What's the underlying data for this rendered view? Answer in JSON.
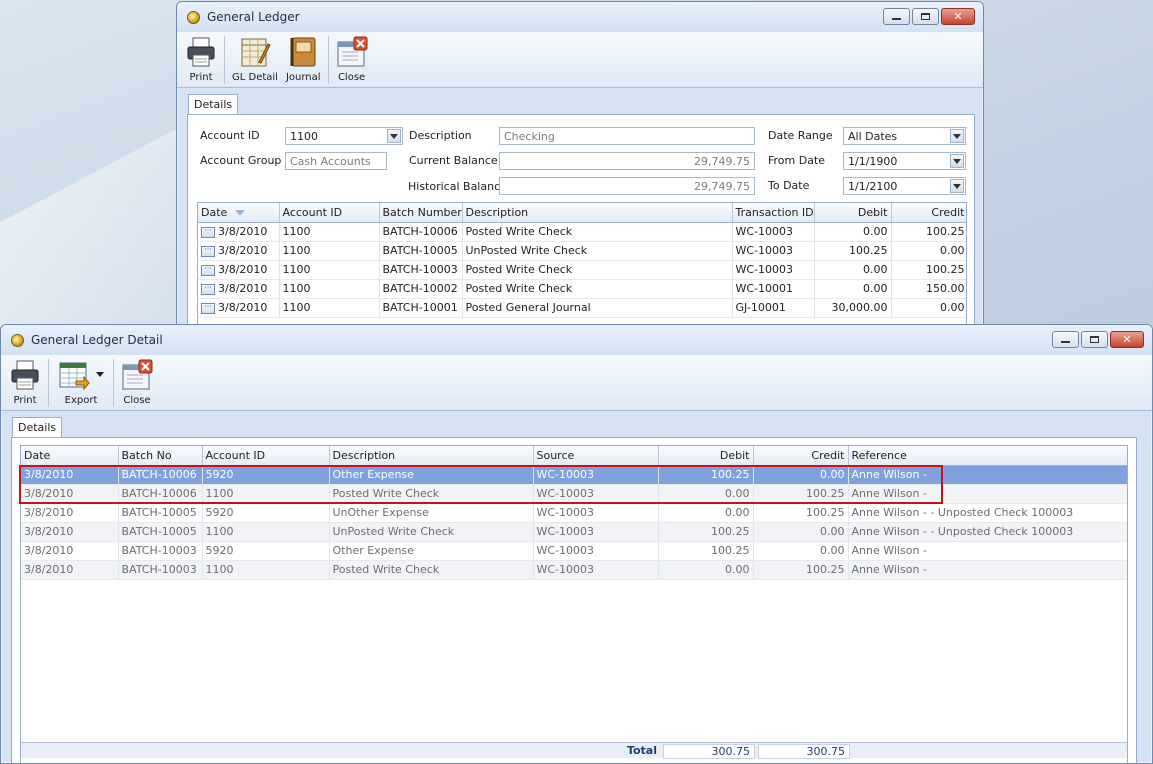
{
  "gl_window": {
    "title": "General Ledger",
    "toolbar": [
      "Print",
      "GL Detail",
      "Journal",
      "Close"
    ],
    "tab": "Details",
    "labels": {
      "account_id": "Account ID",
      "account_group": "Account Group",
      "description": "Description",
      "current_balance": "Current Balance",
      "historical_balance": "Historical Balance",
      "date_range": "Date Range",
      "from_date": "From Date",
      "to_date": "To Date"
    },
    "values": {
      "account_id": "1100",
      "account_group": "Cash Accounts",
      "description": "Checking",
      "current_balance": "29,749.75",
      "historical_balance": "29,749.75",
      "date_range": "All Dates",
      "from_date": "1/1/1900",
      "to_date": "1/1/2100"
    },
    "columns": [
      "Date",
      "Account ID",
      "Batch Number",
      "Description",
      "Transaction ID",
      "Debit",
      "Credit"
    ],
    "rows": [
      [
        "3/8/2010",
        "1100",
        "BATCH-10006",
        "Posted Write Check",
        "WC-10003",
        "0.00",
        "100.25"
      ],
      [
        "3/8/2010",
        "1100",
        "BATCH-10005",
        "UnPosted Write Check",
        "WC-10003",
        "100.25",
        "0.00"
      ],
      [
        "3/8/2010",
        "1100",
        "BATCH-10003",
        "Posted Write Check",
        "WC-10003",
        "0.00",
        "100.25"
      ],
      [
        "3/8/2010",
        "1100",
        "BATCH-10002",
        "Posted Write Check",
        "WC-10001",
        "0.00",
        "150.00"
      ],
      [
        "3/8/2010",
        "1100",
        "BATCH-10001",
        "Posted General Journal",
        "GJ-10001",
        "30,000.00",
        "0.00"
      ]
    ],
    "row_button_text": "···"
  },
  "detail_window": {
    "title": "General Ledger Detail",
    "toolbar": [
      "Print",
      "Export",
      "Close"
    ],
    "tab": "Details",
    "columns": [
      "Date",
      "Batch No",
      "Account ID",
      "Description",
      "Source",
      "Debit",
      "Credit",
      "Reference"
    ],
    "rows": [
      [
        "3/8/2010",
        "BATCH-10006",
        "5920",
        "Other Expense",
        "WC-10003",
        "100.25",
        "0.00",
        "Anne Wilson -"
      ],
      [
        "3/8/2010",
        "BATCH-10006",
        "1100",
        "Posted Write Check",
        "WC-10003",
        "0.00",
        "100.25",
        "Anne Wilson -"
      ],
      [
        "3/8/2010",
        "BATCH-10005",
        "5920",
        "UnOther Expense",
        "WC-10003",
        "0.00",
        "100.25",
        "Anne Wilson - - Unposted Check 100003"
      ],
      [
        "3/8/2010",
        "BATCH-10005",
        "1100",
        "UnPosted Write Check",
        "WC-10003",
        "100.25",
        "0.00",
        "Anne Wilson - - Unposted Check 100003"
      ],
      [
        "3/8/2010",
        "BATCH-10003",
        "5920",
        "Other Expense",
        "WC-10003",
        "100.25",
        "0.00",
        "Anne Wilson -"
      ],
      [
        "3/8/2010",
        "BATCH-10003",
        "1100",
        "Posted Write Check",
        "WC-10003",
        "0.00",
        "100.25",
        "Anne Wilson -"
      ]
    ],
    "selected_row": 0,
    "total_label": "Total",
    "total_debit": "300.75",
    "total_credit": "300.75"
  },
  "colors": {
    "selection": "#7fa2de",
    "highlight_box": "#c3141d",
    "window_chrome": "#d5e3f3"
  }
}
